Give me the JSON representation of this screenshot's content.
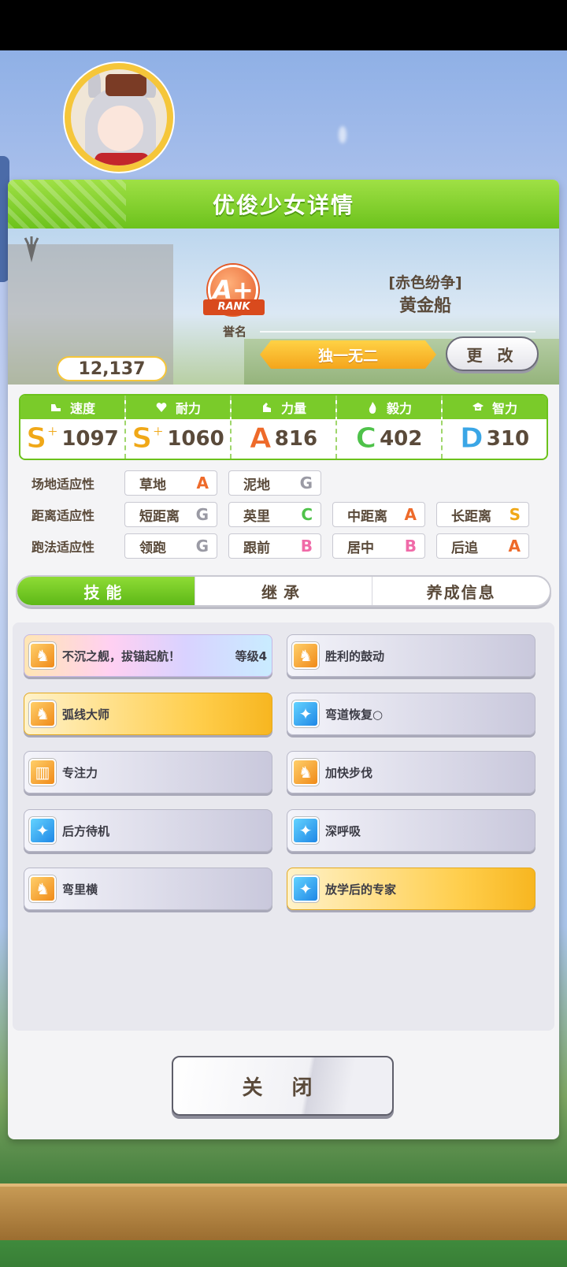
{
  "panel": {
    "title": "优俊少女详情"
  },
  "profile": {
    "fans": "12,137",
    "rank_grade": "A+",
    "rank_word": "RANK",
    "rank_label": "誉名",
    "epithet": "[赤色纷争]",
    "name": "黄金船",
    "title_ribbon": "独一无二",
    "change_button": "更 改"
  },
  "stats": [
    {
      "label": "速度",
      "icon": "shoe-icon",
      "grade": "S",
      "plus": "+",
      "value": "1097",
      "grade_color": "#f0a818"
    },
    {
      "label": "耐力",
      "icon": "heart-icon",
      "grade": "S",
      "plus": "+",
      "value": "1060",
      "grade_color": "#f0a818"
    },
    {
      "label": "力量",
      "icon": "muscle-icon",
      "grade": "A",
      "plus": "",
      "value": "816",
      "grade_color": "#ee6a2a"
    },
    {
      "label": "毅力",
      "icon": "flame-icon",
      "grade": "C",
      "plus": "",
      "value": "402",
      "grade_color": "#4fc24a"
    },
    {
      "label": "智力",
      "icon": "graduation-cap-icon",
      "grade": "D",
      "plus": "",
      "value": "310",
      "grade_color": "#3aa6e6"
    }
  ],
  "aptitudes": {
    "track": {
      "label": "场地适应性",
      "items": [
        {
          "name": "草地",
          "grade": "A",
          "color": "#ee6a2a"
        },
        {
          "name": "泥地",
          "grade": "G",
          "color": "#9a9aa4"
        }
      ]
    },
    "distance": {
      "label": "距离适应性",
      "items": [
        {
          "name": "短距离",
          "grade": "G",
          "color": "#9a9aa4"
        },
        {
          "name": "英里",
          "grade": "C",
          "color": "#4fc24a"
        },
        {
          "name": "中距离",
          "grade": "A",
          "color": "#ee6a2a"
        },
        {
          "name": "长距离",
          "grade": "S",
          "color": "#f0a818"
        }
      ]
    },
    "strategy": {
      "label": "跑法适应性",
      "items": [
        {
          "name": "领跑",
          "grade": "G",
          "color": "#9a9aa4"
        },
        {
          "name": "跟前",
          "grade": "B",
          "color": "#f06aa8"
        },
        {
          "name": "居中",
          "grade": "B",
          "color": "#f06aa8"
        },
        {
          "name": "后追",
          "grade": "A",
          "color": "#ee6a2a"
        }
      ]
    }
  },
  "tabs": [
    {
      "label": "技能",
      "active": true
    },
    {
      "label": "继承",
      "active": false
    },
    {
      "label": "养成信息",
      "active": false
    }
  ],
  "skills": [
    {
      "name": "不沉之舰，拔锚起航！",
      "level": "等级4",
      "style": "rainbow",
      "icon": "horseshoe-icon",
      "icon_style": "orange"
    },
    {
      "name": "胜利的鼓动",
      "level": "",
      "style": "normal",
      "icon": "horseshoe-icon",
      "icon_style": "orange"
    },
    {
      "name": "弧线大师",
      "level": "",
      "style": "gold",
      "icon": "horseshoe-icon",
      "icon_style": "orange"
    },
    {
      "name": "弯道恢复○",
      "level": "",
      "style": "normal",
      "icon": "sparkle-icon",
      "icon_style": "blue"
    },
    {
      "name": "专注力",
      "level": "",
      "style": "normal",
      "icon": "gate-icon",
      "icon_style": "orange"
    },
    {
      "name": "加快步伐",
      "level": "",
      "style": "normal",
      "icon": "horseshoe-icon",
      "icon_style": "orange"
    },
    {
      "name": "后方待机",
      "level": "",
      "style": "normal",
      "icon": "sparkle-icon",
      "icon_style": "blue"
    },
    {
      "name": "深呼吸",
      "level": "",
      "style": "normal",
      "icon": "sparkle-icon",
      "icon_style": "blue"
    },
    {
      "name": "弯里横",
      "level": "",
      "style": "normal",
      "icon": "horseshoe-icon",
      "icon_style": "orange"
    },
    {
      "name": "放学后的专家",
      "level": "",
      "style": "gold",
      "icon": "sparkle-icon",
      "icon_style": "blue"
    }
  ],
  "close_button": "关 闭"
}
